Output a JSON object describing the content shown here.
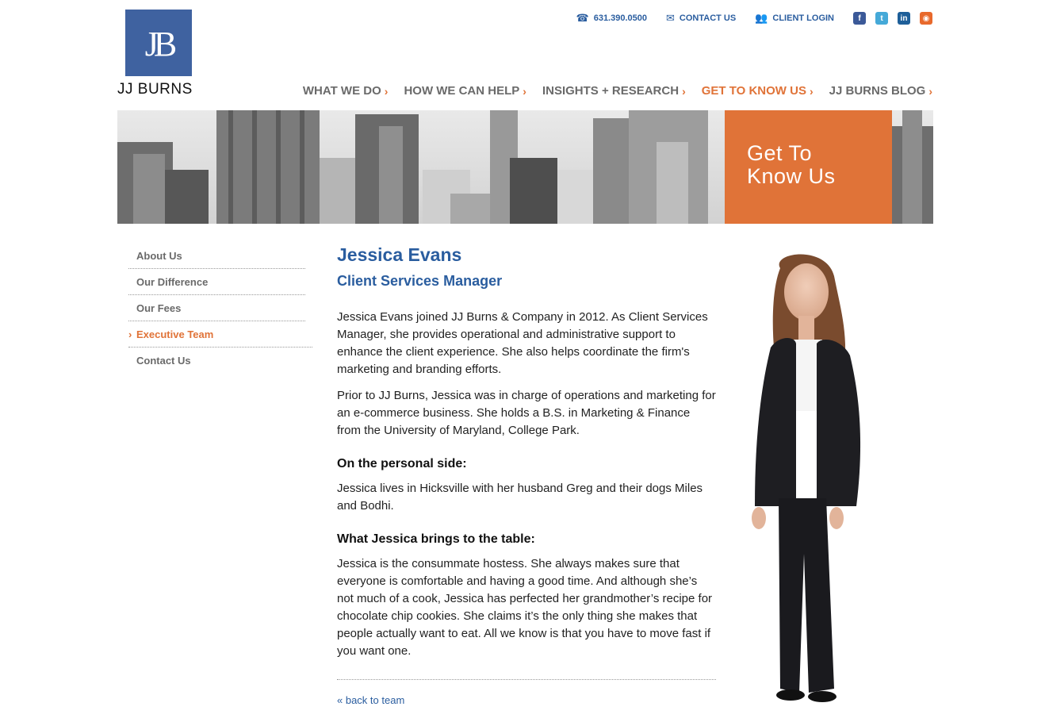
{
  "logo": {
    "monogram": "JB",
    "name": "JJ BURNS"
  },
  "utility": {
    "phone": "631.390.0500",
    "contact": "CONTACT US",
    "login": "CLIENT LOGIN"
  },
  "social": [
    {
      "name": "facebook",
      "glyph": "f",
      "color": "#3b5998"
    },
    {
      "name": "twitter",
      "glyph": "t",
      "color": "#45a9d8"
    },
    {
      "name": "linkedin",
      "glyph": "in",
      "color": "#1e5f99"
    },
    {
      "name": "rss",
      "glyph": "◉",
      "color": "#e8692c"
    }
  ],
  "nav": [
    {
      "label": "WHAT WE DO",
      "active": false
    },
    {
      "label": "HOW WE CAN HELP",
      "active": false
    },
    {
      "label": "INSIGHTS + RESEARCH",
      "active": false
    },
    {
      "label": "GET TO KNOW US",
      "active": true
    },
    {
      "label": "JJ BURNS BLOG",
      "active": false
    }
  ],
  "banner": {
    "line1": "Get To",
    "line2": "Know Us"
  },
  "subnav": [
    {
      "label": "About Us",
      "active": false
    },
    {
      "label": "Our Difference",
      "active": false
    },
    {
      "label": "Our Fees",
      "active": false
    },
    {
      "label": "Executive Team",
      "active": true
    },
    {
      "label": "Contact Us",
      "active": false
    }
  ],
  "profile": {
    "name": "Jessica Evans",
    "role": "Client Services Manager",
    "bio1": "Jessica Evans joined JJ Burns & Company in 2012. As Client Services Manager, she provides operational and administrative support to enhance the client experience. She also helps coordinate the firm's marketing and branding efforts.",
    "bio2": "Prior to JJ Burns, Jessica was in charge of operations and marketing for an e-commerce business. She holds a B.S. in Marketing & Finance from the University of Maryland, College Park.",
    "personal_heading": "On the personal side:",
    "personal": "Jessica lives in Hicksville with her husband Greg and their dogs Miles and Bodhi.",
    "table_heading": "What Jessica brings to the table:",
    "table": "Jessica is the consummate hostess. She always makes sure that everyone is comfortable and having a good time. And although she’s not much of a cook, Jessica has perfected her grandmother’s recipe for chocolate chip cookies. She claims it’s the only thing she makes that people actually want to eat. All we know is that you have to move fast if you want one.",
    "back": "« back to team"
  }
}
